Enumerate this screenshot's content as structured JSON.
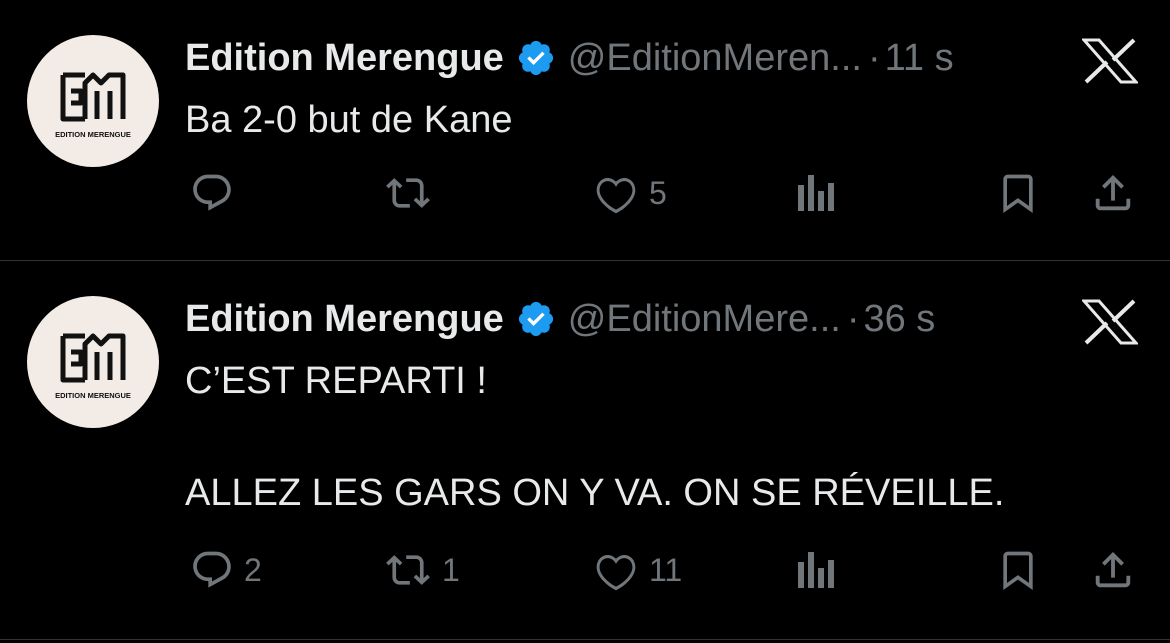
{
  "tweets": [
    {
      "display_name": "Edition Merengue",
      "handle": "@EditionMeren...",
      "separator": "·",
      "time": "11 s",
      "text": "Ba 2-0 but de Kane",
      "avatar_logo_text": "EM",
      "avatar_caption": "EDITION MERENGUE",
      "actions": {
        "reply_count": "",
        "repost_count": "",
        "like_count": "5",
        "views_count": ""
      }
    },
    {
      "display_name": "Edition Merengue",
      "handle": "@EditionMere...",
      "separator": "·",
      "time": "36 s",
      "text": "C’EST REPARTI !\n\nALLEZ LES GARS ON Y VA. ON SE RÉVEILLE.",
      "avatar_logo_text": "EM",
      "avatar_caption": "EDITION MERENGUE",
      "actions": {
        "reply_count": "2",
        "repost_count": "1",
        "like_count": "11",
        "views_count": ""
      }
    }
  ],
  "icons": {
    "verified": "verified-badge-icon",
    "x_logo": "x-logo-icon",
    "reply": "reply-icon",
    "repost": "repost-icon",
    "like": "heart-icon",
    "views": "views-icon",
    "bookmark": "bookmark-icon",
    "share": "share-icon"
  },
  "colors": {
    "background": "#000000",
    "text_primary": "#e7e9ea",
    "text_secondary": "#71767b",
    "verified_blue": "#1d9bf0",
    "divider": "#2f3336",
    "avatar_bg": "#f2ebe6"
  }
}
